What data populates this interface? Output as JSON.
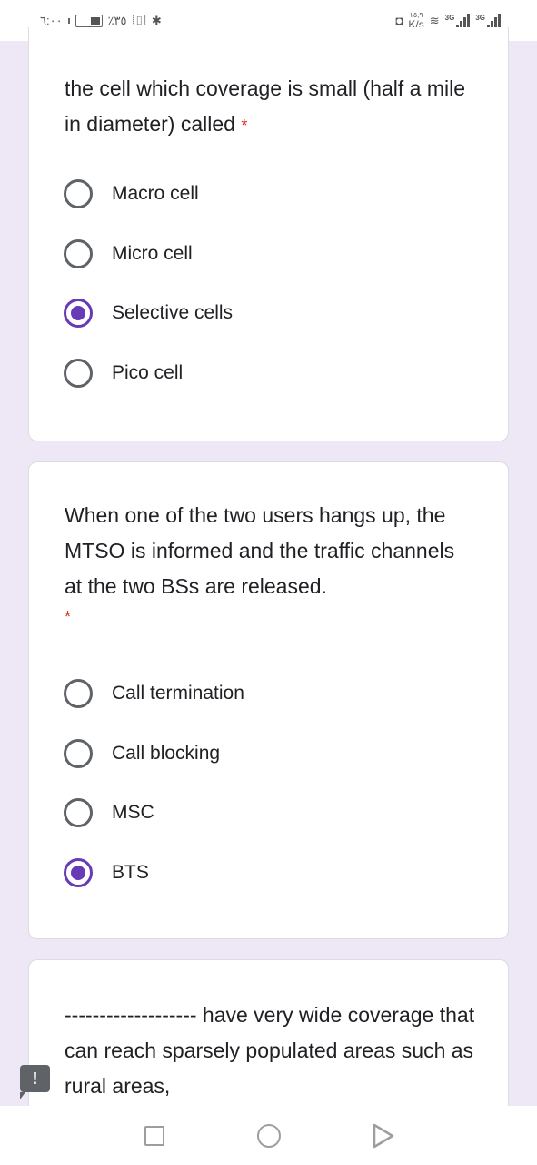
{
  "status_bar": {
    "time": "٦:٠٠",
    "battery_percent": "٪٣٥",
    "net_speed_value": "١٥,٩",
    "net_speed_unit": "K/s",
    "signal1_label": "3G",
    "signal2_label": "3G"
  },
  "questions": [
    {
      "text": "the cell which coverage is small (half a mile in diameter) called",
      "required_marker": "*",
      "options": [
        {
          "label": "Macro cell",
          "selected": false
        },
        {
          "label": "Micro cell",
          "selected": false
        },
        {
          "label": "Selective cells",
          "selected": true
        },
        {
          "label": "Pico cell",
          "selected": false
        }
      ]
    },
    {
      "text": "When one of the two users hangs up, the MTSO is informed and the traffic channels at the two BSs are released.",
      "required_marker": "*",
      "options": [
        {
          "label": "Call termination",
          "selected": false
        },
        {
          "label": "Call blocking",
          "selected": false
        },
        {
          "label": "MSC",
          "selected": false
        },
        {
          "label": "BTS",
          "selected": true
        }
      ]
    },
    {
      "text": "------------------- have very wide coverage that can reach sparsely populated areas such as rural areas,"
    }
  ],
  "feedback_badge": "!",
  "colors": {
    "accent": "#673ab7",
    "background": "#ede7f6",
    "required": "#d93025"
  }
}
